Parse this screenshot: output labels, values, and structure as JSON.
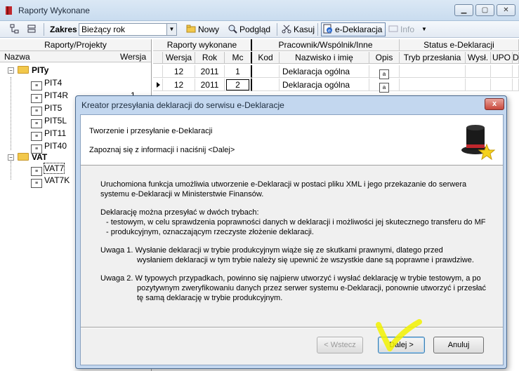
{
  "window": {
    "title": "Raporty Wykonane"
  },
  "toolbar": {
    "zakres_label": "Zakres",
    "zakres_value": "Bieżący rok",
    "new_label": "Nowy",
    "preview_label": "Podgląd",
    "delete_label": "Kasuj",
    "edeklaracja_label": "e-Deklaracja",
    "info_label": "Info"
  },
  "left_panel": {
    "header": "Raporty/Projekty",
    "col_name": "Nazwa",
    "col_version": "Wersja",
    "groups": [
      {
        "label": "PITy",
        "items": [
          "PIT4",
          "PIT4R",
          "PIT5",
          "PIT5L",
          "PIT11",
          "PIT40"
        ],
        "versions": [
          "",
          "1",
          "",
          "",
          "",
          ""
        ]
      },
      {
        "label": "VAT",
        "items": [
          "VAT7",
          "VAT7K"
        ]
      }
    ]
  },
  "grid": {
    "group_headers": [
      "Raporty wykonane",
      "Pracownik/Wspólnik/Inne",
      "Status e-Deklaracji"
    ],
    "columns": [
      "Wersja",
      "Rok",
      "Mc",
      "Kod",
      "Nazwisko i imię",
      "Opis",
      "Tryb przesłania",
      "Wysł.",
      "UPO",
      "D"
    ],
    "rows": [
      {
        "wersja": "12",
        "rok": "2011",
        "mc": "1",
        "kod": "",
        "nazwisko": "Deklaracja ogólna"
      },
      {
        "wersja": "12",
        "rok": "2011",
        "mc": "2",
        "kod": "",
        "nazwisko": "Deklaracja ogólna"
      }
    ]
  },
  "dialog": {
    "title": "Kreator przesyłania deklaracji do serwisu e-Deklaracje",
    "close_label": "x",
    "header_title": "Tworzenie i przesyłanie e-Deklaracji",
    "header_subtitle": "Zapoznaj się z informacji i naciśnij <Dalej>",
    "body": {
      "p1_line1": "Uruchomiona funkcja umożliwia utworzenie e-Deklaracji w postaci pliku XML i jego przekazanie do serwera",
      "p1_line2": "systemu e-Deklaracji w Ministerstwie Finansów.",
      "p2_line1": "Deklarację można przesyłać w dwóch trybach:",
      "p2_line2": "-  testowym,  w celu sprawdzenia poprawności danych w deklaracji i możliwości jej skutecznego transferu do MF",
      "p2_line3": "-  produkcyjnym, oznaczającym rzeczyste złożenie deklaracji.",
      "p3_line1": "Uwaga 1.  Wysłanie deklaracji w trybie produkcyjnym wiąże się ze skutkami prawnymi, dlatego przed",
      "p3_line2": "wysłaniem deklaracji w tym trybie należy się upewnić że wszystkie dane są poprawne i prawdziwe.",
      "p4_line1": "Uwaga 2.  W typowych przypadkach, powinno się najpierw utworzyć i wysłać deklarację w trybie testowym, a po",
      "p4_line2": "pozytywnym zweryfikowaniu danych przez serwer systemu e-Deklaracji, ponownie utworzyć i przesłać",
      "p4_line3": "tę samą deklarację w trybie produkcyjnym."
    },
    "buttons": {
      "back": "< Wstecz",
      "next": "Dalej >",
      "cancel": "Anuluj"
    }
  },
  "colors": {
    "dialog_frame": "#c3d7ef",
    "highlight": "#f2f200"
  }
}
